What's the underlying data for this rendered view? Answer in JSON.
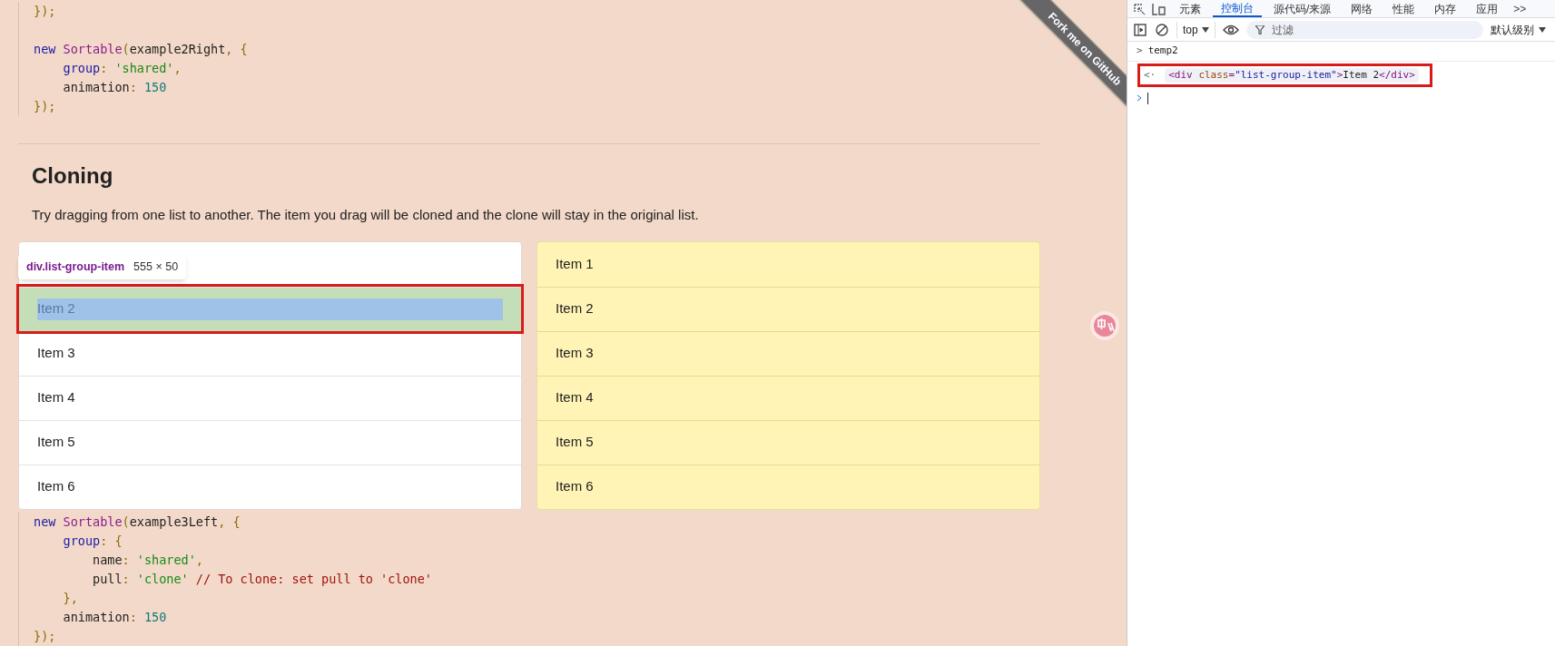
{
  "code_top": [
    [
      [
        {
          "text": "});",
          "kind": "punct"
        }
      ]
    ],
    [
      [
        {
          "text": "new ",
          "kind": "keyword"
        },
        {
          "text": "Sortable",
          "kind": "class"
        },
        {
          "text": "(",
          "kind": "punct"
        },
        {
          "text": "example2Right",
          "kind": "plain"
        },
        {
          "text": ", {",
          "kind": "punct"
        }
      ],
      [
        {
          "text": "    group",
          "kind": "prop"
        },
        {
          "text": ": ",
          "kind": "punct"
        },
        {
          "text": "'shared'",
          "kind": "string"
        },
        {
          "text": ",",
          "kind": "punct"
        }
      ],
      [
        {
          "text": "    animation",
          "kind": "plain"
        },
        {
          "text": ": ",
          "kind": "punct"
        },
        {
          "text": "150",
          "kind": "number"
        }
      ],
      [
        {
          "text": "});",
          "kind": "punct"
        }
      ]
    ]
  ],
  "section": {
    "heading": "Cloning",
    "description": "Try dragging from one list to another. The item you drag will be cloned and the clone will stay in the original list."
  },
  "left_list": [
    {
      "label": "Item 2",
      "selected": true
    },
    {
      "label": "Item 3",
      "selected": false
    },
    {
      "label": "Item 4",
      "selected": false
    },
    {
      "label": "Item 5",
      "selected": false
    },
    {
      "label": "Item 6",
      "selected": false
    }
  ],
  "right_list": [
    {
      "label": "Item 1"
    },
    {
      "label": "Item 2"
    },
    {
      "label": "Item 3"
    },
    {
      "label": "Item 4"
    },
    {
      "label": "Item 5"
    },
    {
      "label": "Item 6"
    }
  ],
  "inspect_tooltip": {
    "selector": "div.list-group-item",
    "size": "555 × 50"
  },
  "code_bottom": [
    [
      [
        {
          "text": "new ",
          "kind": "keyword"
        },
        {
          "text": "Sortable",
          "kind": "class"
        },
        {
          "text": "(",
          "kind": "punct"
        },
        {
          "text": "example3Left",
          "kind": "plain"
        },
        {
          "text": ", {",
          "kind": "punct"
        }
      ],
      [
        {
          "text": "    group",
          "kind": "prop"
        },
        {
          "text": ": {",
          "kind": "punct"
        }
      ],
      [
        {
          "text": "        name",
          "kind": "plain"
        },
        {
          "text": ": ",
          "kind": "punct"
        },
        {
          "text": "'shared'",
          "kind": "string"
        },
        {
          "text": ",",
          "kind": "punct"
        }
      ],
      [
        {
          "text": "        pull",
          "kind": "plain"
        },
        {
          "text": ": ",
          "kind": "punct"
        },
        {
          "text": "'clone'",
          "kind": "string"
        },
        {
          "text": " // To clone: set pull to 'clone'",
          "kind": "comment"
        }
      ],
      [
        {
          "text": "    },",
          "kind": "punct"
        }
      ],
      [
        {
          "text": "    animation",
          "kind": "plain"
        },
        {
          "text": ": ",
          "kind": "punct"
        },
        {
          "text": "150",
          "kind": "number"
        }
      ],
      [
        {
          "text": "});",
          "kind": "punct"
        }
      ]
    ]
  ],
  "ribbon": {
    "text": "Fork me on GitHub"
  },
  "devtools": {
    "tabs": [
      {
        "label": "元素",
        "selected": false
      },
      {
        "label": "控制台",
        "selected": true
      },
      {
        "label": "源代码/来源",
        "selected": false
      },
      {
        "label": "网络",
        "selected": false
      },
      {
        "label": "性能",
        "selected": false
      },
      {
        "label": "内存",
        "selected": false
      },
      {
        "label": "应用",
        "selected": false
      }
    ],
    "more": ">>",
    "context": "top",
    "filter": {
      "placeholder": "过滤"
    },
    "level": "默认级别",
    "console": [
      {
        "kind": "input",
        "marker": ">",
        "text": "temp2"
      },
      {
        "kind": "output",
        "marker": "<·",
        "tokens": [
          {
            "text": "<div ",
            "kind": "tag"
          },
          {
            "text": "class",
            "kind": "attr"
          },
          {
            "text": "=",
            "kind": "tag"
          },
          {
            "text": "\"list-group-item\"",
            "kind": "value"
          },
          {
            "text": ">",
            "kind": "tag"
          },
          {
            "text": "Item 2",
            "kind": "plain"
          },
          {
            "text": "</div>",
            "kind": "tag"
          }
        ]
      },
      {
        "kind": "prompt"
      }
    ]
  }
}
